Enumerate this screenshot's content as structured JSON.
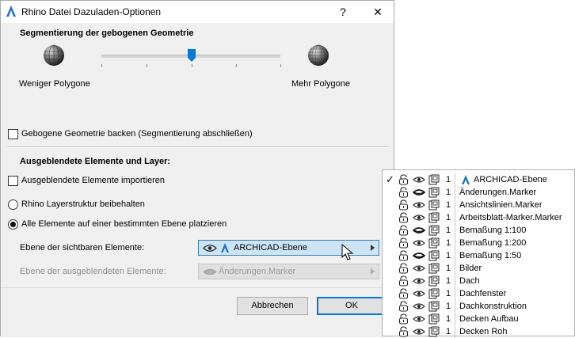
{
  "dialog": {
    "title": "Rhino Datei Dazuladen-Optionen",
    "help_label": "?",
    "close_label": "✕",
    "app_icon": "archicad-icon"
  },
  "segmentation": {
    "heading": "Segmentierung der gebogenen Geometrie",
    "less_label": "Weniger Polygone",
    "more_label": "Mehr Polygone",
    "slider_level": 0.5,
    "bake_checkbox": {
      "label": "Gebogene Geometrie backen (Segmentierung abschließen)",
      "checked": false
    }
  },
  "hidden": {
    "heading": "Ausgeblendete Elemente und Layer:",
    "import_checkbox": {
      "label": "Ausgeblendete Elemente importieren",
      "checked": false
    },
    "radio_keep": {
      "label": "Rhino Layerstruktur beibehalten",
      "selected": false
    },
    "radio_place": {
      "label": "Alle Elemente auf einer bestimmten Ebene platzieren",
      "selected": true
    },
    "visible_layer": {
      "label": "Ebene der sichtbaren Elemente:",
      "value": "ARCHICAD-Ebene"
    },
    "hidden_layer": {
      "label": "Ebene der ausgeblendeten Elemente:",
      "value": "Änderungen.Marker"
    }
  },
  "buttons": {
    "cancel": "Abbrechen",
    "ok": "OK"
  },
  "dropdown": {
    "items": [
      {
        "check": "✓",
        "num": "1",
        "name": "ARCHICAD-Ebene",
        "eye": "open"
      },
      {
        "check": "",
        "num": "1",
        "name": "Änderungen.Marker",
        "eye": "closed"
      },
      {
        "check": "",
        "num": "1",
        "name": "Ansichtslinien.Marker",
        "eye": "open"
      },
      {
        "check": "",
        "num": "1",
        "name": "Arbeitsblatt-Marker.Marker",
        "eye": "open"
      },
      {
        "check": "",
        "num": "1",
        "name": "Bemaßung 1:100",
        "eye": "closed"
      },
      {
        "check": "",
        "num": "1",
        "name": "Bemaßung 1:200",
        "eye": "open"
      },
      {
        "check": "",
        "num": "1",
        "name": "Bemaßung 1:50",
        "eye": "closed"
      },
      {
        "check": "",
        "num": "1",
        "name": "Bilder",
        "eye": "open"
      },
      {
        "check": "",
        "num": "1",
        "name": "Dach",
        "eye": "open"
      },
      {
        "check": "",
        "num": "1",
        "name": "Dachfenster",
        "eye": "open"
      },
      {
        "check": "",
        "num": "1",
        "name": "Dachkonstruktion",
        "eye": "open"
      },
      {
        "check": "",
        "num": "1",
        "name": "Decken Aufbau",
        "eye": "open"
      },
      {
        "check": "",
        "num": "1",
        "name": "Decken Roh",
        "eye": "open"
      }
    ]
  }
}
